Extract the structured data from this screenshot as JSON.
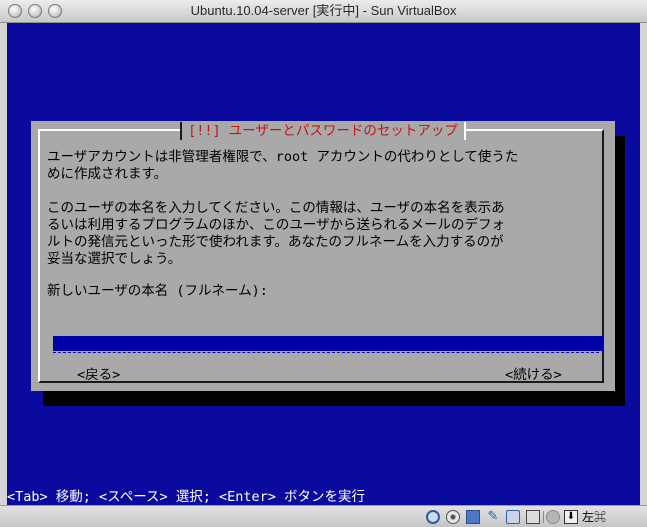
{
  "window": {
    "title": "Ubuntu.10.04-server [実行中] - Sun VirtualBox"
  },
  "dialog": {
    "title": "[!!] ユーザーとパスワードのセットアップ",
    "body": "ユーザアカウントは非管理者権限で、root アカウントの代わりとして使うた\nめに作成されます。\n\nこのユーザの本名を入力してください。この情報は、ユーザの本名を表示あ\nるいは利用するプログラムのほか、このユーザから送られるメールのデフォ\nルトの発信元といった形で使われます。あなたのフルネームを入力するのが\n妥当な選択でしょう。",
    "field_label": "新しいユーザの本名 (フルネーム):",
    "field_value": "",
    "back_label": "<戻る>",
    "continue_label": "<続ける>"
  },
  "help_line": "<Tab> 移動; <スペース> 選択; <Enter> ボタンを実行",
  "statusbar": {
    "host_key": "左⌘"
  },
  "colors": {
    "screen_background": "#0a0a9e",
    "dialog_background": "#a9a9a9",
    "dialog_title": "#c61414",
    "input_background": "#0000a8"
  },
  "icons": [
    "hard-disk-icon",
    "optical-disc-icon",
    "floppy-icon",
    "pencil-icon",
    "network-icon",
    "usb-icon",
    "shared-folder-icon",
    "mouse-capture-icon"
  ]
}
